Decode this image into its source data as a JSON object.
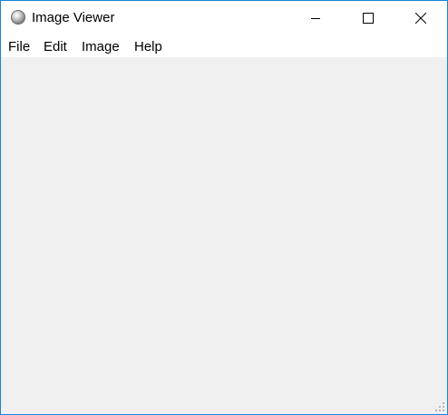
{
  "window": {
    "title": "Image Viewer",
    "icon": "app-icon"
  },
  "menu": {
    "items": [
      {
        "label": "File"
      },
      {
        "label": "Edit"
      },
      {
        "label": "Image"
      },
      {
        "label": "Help"
      }
    ]
  },
  "colors": {
    "border": "#1883d7",
    "titlebar": "#ffffff",
    "content": "#f0f0f0"
  }
}
